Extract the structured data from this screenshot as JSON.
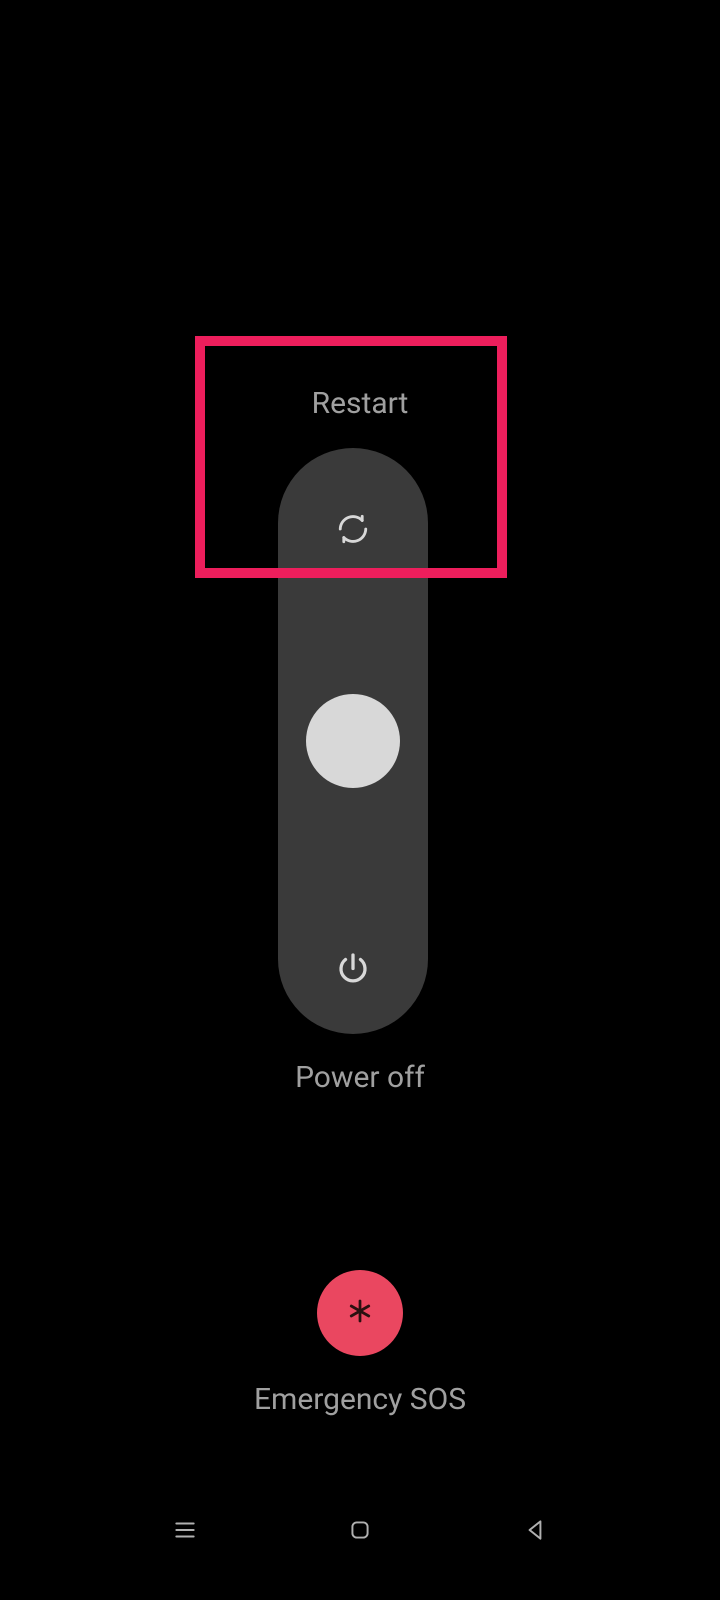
{
  "slider": {
    "restart_label": "Restart",
    "poweroff_label": "Power off"
  },
  "sos": {
    "label": "Emergency SOS"
  },
  "colors": {
    "highlight": "#ed1e5c",
    "sos_bg": "#ea4760",
    "track": "#3a3a3a",
    "knob": "#d8d8d8",
    "text": "#a0a0a0"
  }
}
